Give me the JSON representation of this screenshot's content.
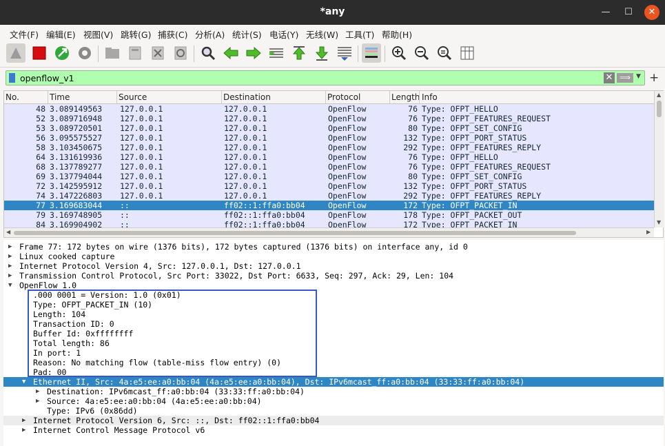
{
  "window": {
    "title": "*any"
  },
  "menu": [
    "文件(F)",
    "编辑(E)",
    "视图(V)",
    "跳转(G)",
    "捕获(C)",
    "分析(A)",
    "统计(S)",
    "电话(Y)",
    "无线(W)",
    "工具(T)",
    "帮助(H)"
  ],
  "filter": {
    "value": "openflow_v1"
  },
  "columns": [
    "No.",
    "Time",
    "Source",
    "Destination",
    "Protocol",
    "Length",
    "Info"
  ],
  "packets": [
    {
      "no": "48",
      "time": "3.089149563",
      "source": "127.0.0.1",
      "destination": "127.0.0.1",
      "protocol": "OpenFlow",
      "length": "76",
      "info": "Type: OFPT_HELLO"
    },
    {
      "no": "52",
      "time": "3.089716948",
      "source": "127.0.0.1",
      "destination": "127.0.0.1",
      "protocol": "OpenFlow",
      "length": "76",
      "info": "Type: OFPT_FEATURES_REQUEST"
    },
    {
      "no": "53",
      "time": "3.089720501",
      "source": "127.0.0.1",
      "destination": "127.0.0.1",
      "protocol": "OpenFlow",
      "length": "80",
      "info": "Type: OFPT_SET_CONFIG"
    },
    {
      "no": "56",
      "time": "3.095575527",
      "source": "127.0.0.1",
      "destination": "127.0.0.1",
      "protocol": "OpenFlow",
      "length": "132",
      "info": "Type: OFPT_PORT_STATUS"
    },
    {
      "no": "58",
      "time": "3.103450675",
      "source": "127.0.0.1",
      "destination": "127.0.0.1",
      "protocol": "OpenFlow",
      "length": "292",
      "info": "Type: OFPT_FEATURES_REPLY"
    },
    {
      "no": "64",
      "time": "3.131619936",
      "source": "127.0.0.1",
      "destination": "127.0.0.1",
      "protocol": "OpenFlow",
      "length": "76",
      "info": "Type: OFPT_HELLO"
    },
    {
      "no": "68",
      "time": "3.137789277",
      "source": "127.0.0.1",
      "destination": "127.0.0.1",
      "protocol": "OpenFlow",
      "length": "76",
      "info": "Type: OFPT_FEATURES_REQUEST"
    },
    {
      "no": "69",
      "time": "3.137794044",
      "source": "127.0.0.1",
      "destination": "127.0.0.1",
      "protocol": "OpenFlow",
      "length": "80",
      "info": "Type: OFPT_SET_CONFIG"
    },
    {
      "no": "72",
      "time": "3.142595912",
      "source": "127.0.0.1",
      "destination": "127.0.0.1",
      "protocol": "OpenFlow",
      "length": "132",
      "info": "Type: OFPT_PORT_STATUS"
    },
    {
      "no": "74",
      "time": "3.147226803",
      "source": "127.0.0.1",
      "destination": "127.0.0.1",
      "protocol": "OpenFlow",
      "length": "292",
      "info": "Type: OFPT_FEATURES_REPLY"
    },
    {
      "no": "77",
      "time": "3.169683044",
      "source": "::",
      "destination": "ff02::1:ffa0:bb04",
      "protocol": "OpenFlow",
      "length": "172",
      "info": "Type: OFPT_PACKET_IN",
      "selected": true
    },
    {
      "no": "79",
      "time": "3.169748905",
      "source": "::",
      "destination": "ff02::1:ffa0:bb04",
      "protocol": "OpenFlow",
      "length": "178",
      "info": "Type: OFPT_PACKET_OUT"
    },
    {
      "no": "84",
      "time": "3.169904902",
      "source": "::",
      "destination": "ff02::1:ffa0:bb04",
      "protocol": "OpenFlow",
      "length": "172",
      "info": "Type: OFPT_PACKET_IN"
    }
  ],
  "details": [
    {
      "text": "Frame 77: 172 bytes on wire (1376 bits), 172 bytes captured (1376 bits) on interface any, id 0",
      "level": 0,
      "state": "collapsed"
    },
    {
      "text": "Linux cooked capture",
      "level": 0,
      "state": "collapsed"
    },
    {
      "text": "Internet Protocol Version 4, Src: 127.0.0.1, Dst: 127.0.0.1",
      "level": 0,
      "state": "collapsed"
    },
    {
      "text": "Transmission Control Protocol, Src Port: 33022, Dst Port: 6633, Seq: 297, Ack: 29, Len: 104",
      "level": 0,
      "state": "collapsed"
    },
    {
      "text": "OpenFlow 1.0",
      "level": 0,
      "state": "expanded"
    },
    {
      "text": ".000 0001 = Version: 1.0 (0x01)",
      "level": 1,
      "state": "leaf"
    },
    {
      "text": "Type: OFPT_PACKET_IN (10)",
      "level": 1,
      "state": "leaf"
    },
    {
      "text": "Length: 104",
      "level": 1,
      "state": "leaf"
    },
    {
      "text": "Transaction ID: 0",
      "level": 1,
      "state": "leaf"
    },
    {
      "text": "Buffer Id: 0xffffffff",
      "level": 1,
      "state": "leaf"
    },
    {
      "text": "Total length: 86",
      "level": 1,
      "state": "leaf"
    },
    {
      "text": "In port: 1",
      "level": 1,
      "state": "leaf"
    },
    {
      "text": "Reason: No matching flow (table-miss flow entry) (0)",
      "level": 1,
      "state": "leaf"
    },
    {
      "text": "Pad: 00",
      "level": 1,
      "state": "leaf"
    },
    {
      "text": "Ethernet II, Src: 4a:e5:ee:a0:bb:04 (4a:e5:ee:a0:bb:04), Dst: IPv6mcast_ff:a0:bb:04 (33:33:ff:a0:bb:04)",
      "level": 1,
      "state": "expanded",
      "highlighted": true
    },
    {
      "text": "Destination: IPv6mcast_ff:a0:bb:04 (33:33:ff:a0:bb:04)",
      "level": 2,
      "state": "collapsed"
    },
    {
      "text": "Source: 4a:e5:ee:a0:bb:04 (4a:e5:ee:a0:bb:04)",
      "level": 2,
      "state": "collapsed"
    },
    {
      "text": "Type: IPv6 (0x86dd)",
      "level": 2,
      "state": "leaf"
    },
    {
      "text": "Internet Protocol Version 6, Src: ::, Dst: ff02::1:ffa0:bb04",
      "level": 1,
      "state": "collapsed",
      "shaded": true
    },
    {
      "text": "Internet Control Message Protocol v6",
      "level": 1,
      "state": "collapsed"
    }
  ],
  "colors": {
    "row_bg": "#e7e6ff",
    "selected_bg": "#2f86c5",
    "filter_bg": "#afffaf",
    "annotation_box": "#3a56c5",
    "close_button": "#e95420"
  }
}
